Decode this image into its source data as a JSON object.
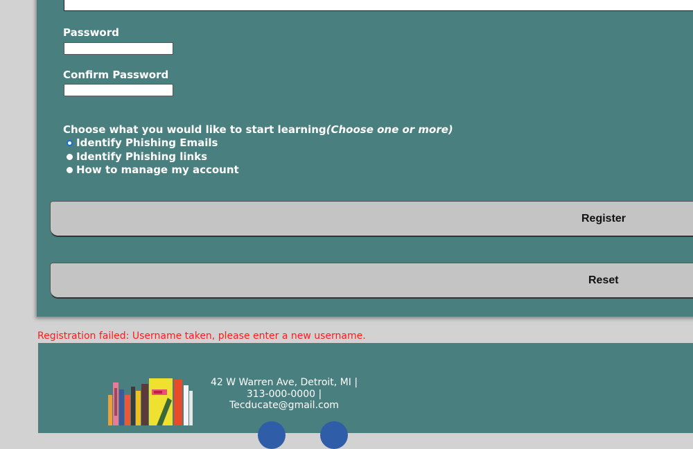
{
  "form": {
    "password_label": "Password",
    "confirm_password_label": "Confirm Password",
    "learning_prompt": "Choose what you would like to start learning",
    "learning_hint": "(Choose one or more)",
    "options": [
      {
        "label": "Identify Phishing Emails",
        "selected": true
      },
      {
        "label": "Identify Phishing links",
        "selected": false
      },
      {
        "label": "How to manage my account",
        "selected": false
      }
    ],
    "register_label": "Register",
    "reset_label": "Reset"
  },
  "error_message": "Registration failed: Username taken, please enter a new username.",
  "footer": {
    "address": "42 W Warren Ave, Detroit, MI |",
    "phone": "313-000-0000 |",
    "email": "Tecducate@gmail.com"
  },
  "colors": {
    "panel": "#4a7f7f",
    "background": "#d2d2d2",
    "error": "#ff1a1a",
    "button": "#c4c4c4"
  }
}
